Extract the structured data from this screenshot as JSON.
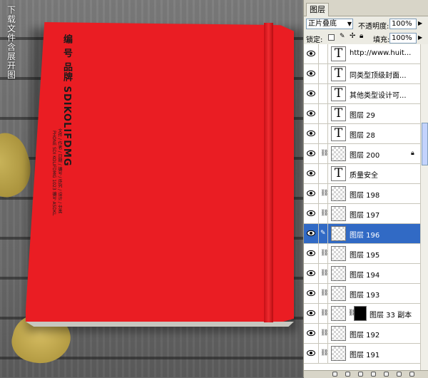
{
  "canvas": {
    "overlay_text": "下载文件含展开图",
    "cover": {
      "title": "编 号 品牌 SDIKOLIFDMG",
      "subtitle_1": "文件 / 作者 / 日期 / 编号 / 序列 / 设计 / 分类",
      "subtitle_2": "PHONE SDI KOLIFDMG 1023 编号 ASDKL"
    },
    "book_color": "#ea1d23"
  },
  "panel": {
    "tab_label": "图层",
    "blend_mode": "正片叠底",
    "opacity_label": "不透明度:",
    "opacity_value": "100%",
    "lock_label": "锁定:",
    "fill_label": "填充:",
    "fill_value": "100%",
    "selected_color": "#316ac5",
    "layers": [
      {
        "name": "http://www.huit...",
        "type": "text",
        "visible": true
      },
      {
        "name": "同类型顶级封面...",
        "type": "text",
        "visible": true
      },
      {
        "name": "其他类型设计可...",
        "type": "text",
        "visible": true
      },
      {
        "name": "图层 29",
        "type": "text",
        "visible": true
      },
      {
        "name": "图层 28",
        "type": "text",
        "visible": true
      },
      {
        "name": "图层 200",
        "type": "pixel",
        "visible": true,
        "locked": true
      },
      {
        "name": "质量安全",
        "type": "text",
        "visible": true
      },
      {
        "name": "图层 198",
        "type": "pixel",
        "visible": true
      },
      {
        "name": "图层 197",
        "type": "pixel",
        "visible": true
      },
      {
        "name": "图层 196",
        "type": "pixel",
        "visible": true,
        "selected": true
      },
      {
        "name": "图层 195",
        "type": "pixel",
        "visible": true
      },
      {
        "name": "图层 194",
        "type": "pixel",
        "visible": true
      },
      {
        "name": "图层 193",
        "type": "pixel",
        "visible": true
      },
      {
        "name": "图层 33 副本",
        "type": "pixel",
        "visible": true,
        "mask": true
      },
      {
        "name": "图层 192",
        "type": "pixel",
        "visible": true
      },
      {
        "name": "图层 191",
        "type": "pixel",
        "visible": true
      }
    ]
  }
}
